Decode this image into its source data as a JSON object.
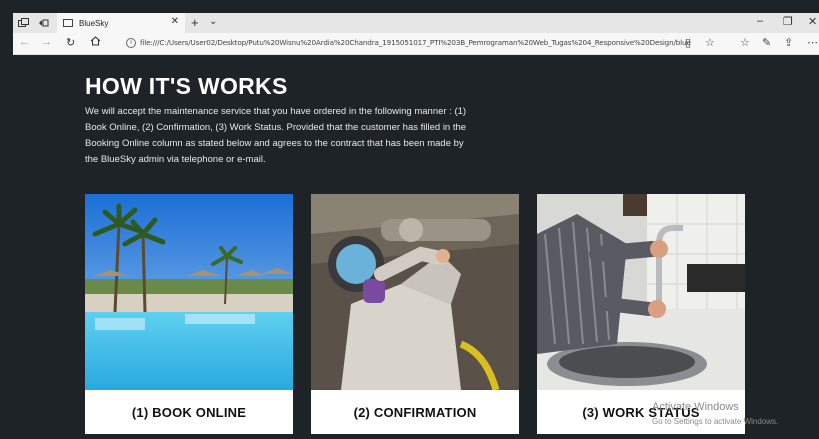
{
  "browser": {
    "tab_title": "BlueSky",
    "url": "file:///C:/Users/User02/Desktop/Putu%20Wisnu%20Ardia%20Chandra_1915051017_PTI%203B_Pemrograman%20Web_Tugas%204_Responsive%20Design/blue"
  },
  "page": {
    "heading": "HOW IT'S WORKS",
    "description": "We will accept the maintenance service that you have ordered in the following manner : (1) Book Online, (2) Confirmation, (3) Work Status. Provided that the customer has filled in the Booking Online column as stated below and agrees to the contract that has been made by the BlueSky admin via telephone or e-mail.",
    "steps": [
      {
        "label": "(1) BOOK ONLINE",
        "image": "resort-pool-photo"
      },
      {
        "label": "(2) CONFIRMATION",
        "image": "worker-with-respirator-photo"
      },
      {
        "label": "(3) WORK STATUS",
        "image": "plumber-fixing-faucet-photo"
      }
    ]
  },
  "overlay": {
    "watermark_line1": "Activate Windows",
    "watermark_line2": "Go to Settings to activate Windows."
  },
  "colors": {
    "page_background": "#1e2328",
    "card_background": "#ffffff",
    "heading_text": "#ffffff"
  }
}
